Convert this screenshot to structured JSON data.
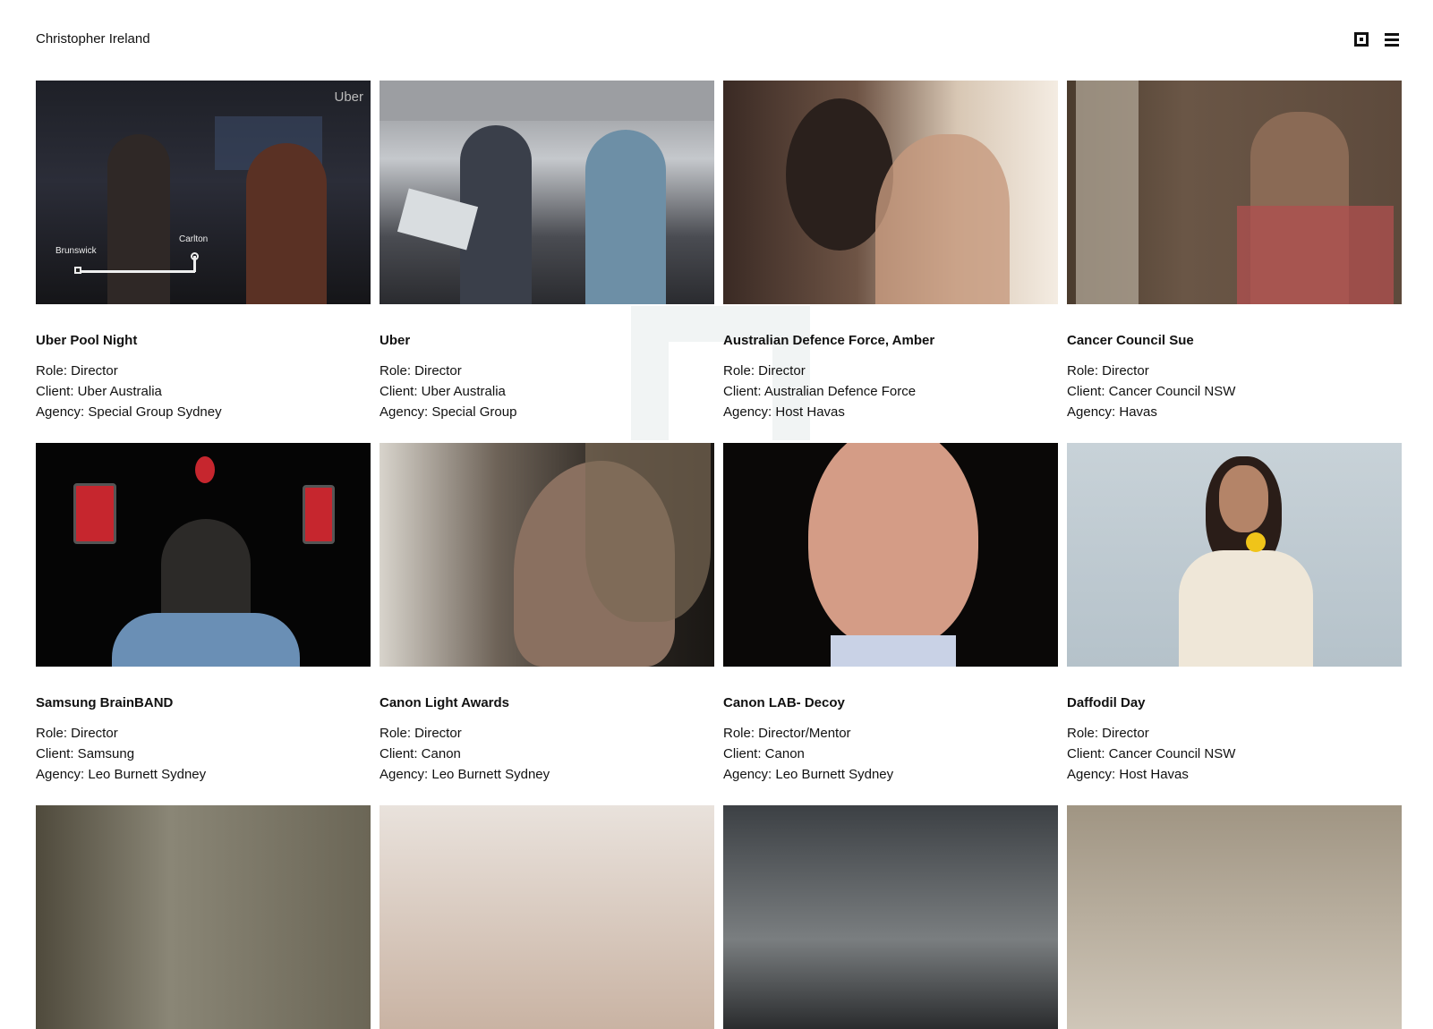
{
  "header": {
    "site_title": "Christopher Ireland",
    "grid_icon": "grid-view-icon",
    "menu_icon": "hamburger-menu-icon"
  },
  "colors": {
    "text": "#111111",
    "background": "#ffffff",
    "watermark": "#f1f4f4"
  },
  "projects": [
    {
      "title": "Uber Pool Night",
      "role": "Role: Director",
      "client": "Client: Uber Australia",
      "agency": "Agency: Special Group Sydney",
      "overlay": {
        "brand": "Uber",
        "from": "Brunswick",
        "to": "Carlton"
      }
    },
    {
      "title": "Uber",
      "role": "Role: Director",
      "client": "Client: Uber Australia",
      "agency": "Agency: Special Group"
    },
    {
      "title": "Australian Defence Force, Amber",
      "role": "Role: Director",
      "client": "Client: Australian Defence Force",
      "agency": "Agency: Host Havas"
    },
    {
      "title": "Cancer Council Sue",
      "role": "Role: Director",
      "client": "Client: Cancer Council NSW",
      "agency": "Agency: Havas"
    },
    {
      "title": "Samsung BrainBAND",
      "role": "Role: Director",
      "client": "Client: Samsung",
      "agency": "Agency: Leo Burnett Sydney"
    },
    {
      "title": "Canon Light Awards",
      "role": "Role: Director",
      "client": "Client: Canon",
      "agency": "Agency: Leo Burnett Sydney"
    },
    {
      "title": "Canon LAB- Decoy",
      "role": "Role: Director/Mentor",
      "client": "Client: Canon",
      "agency": "Agency: Leo Burnett Sydney"
    },
    {
      "title": "Daffodil Day",
      "role": "Role: Director",
      "client": "Client: Cancer Council NSW",
      "agency": "Agency: Host Havas"
    }
  ]
}
